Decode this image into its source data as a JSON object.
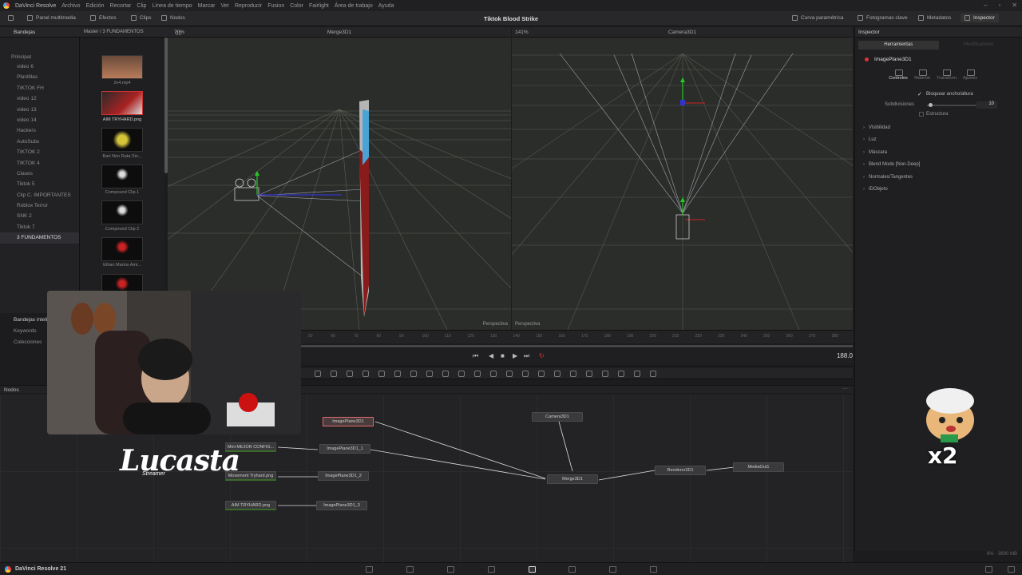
{
  "app": {
    "name": "DaVinci Resolve",
    "footer_name": "DaVinci Resolve 21"
  },
  "menu": [
    "Archivo",
    "Edición",
    "Recortar",
    "Clip",
    "Línea de tiempo",
    "Marcar",
    "Ver",
    "Reproducir",
    "Fusion",
    "Color",
    "Fairlight",
    "Área de trabajo",
    "Ayuda"
  ],
  "toolbar": {
    "media_pool": "Panel multimedia",
    "effects": "Efectos",
    "clips": "Clips",
    "nodes": "Nodos",
    "project_title": "Tiktok Blood Strike",
    "curves": "Curva paramétrica",
    "keyframes": "Fotogramas clave",
    "metadata": "Metadatos",
    "inspector": "Inspector"
  },
  "media_pool": {
    "bins_title": "Bandejas",
    "path": "Master / 3 FUNDAMENTOS",
    "root": "Principal",
    "bins": [
      "video 6",
      "Plantillas",
      "TIKTOK FH",
      "video 12",
      "video 13",
      "video 14",
      "Hackers",
      "AutoSubs",
      "TIKTOK 2",
      "TIKTOK 4",
      "Clases",
      "Tiktok 5",
      "Clip C. IMPORTANTES",
      "Roblox Terror",
      "SNK 2",
      "Tiktok 7",
      "3 FUNDAMENTOS"
    ],
    "selected_bin": "3 FUNDAMENTOS",
    "smart_bins_title": "Bandejas inteligentes",
    "smart_bins": [
      "Keywords",
      "Colecciones"
    ],
    "clips": [
      "2v4.mp4",
      "AIM TRYHARD.png",
      "Bart Nrio Rata Sin...",
      "Compound Clip 1",
      "Compound Clip 2",
      "Ethan Marios Ami..."
    ]
  },
  "viewer_left": {
    "title": "Merge3D1",
    "zoom": "70%",
    "label": "Perspectiva"
  },
  "viewer_right": {
    "title": "Camera3D1",
    "zoom": "141%",
    "label": "Perspectiva"
  },
  "timeline": {
    "ticks": [
      "50",
      "60",
      "70",
      "80",
      "90",
      "100",
      "110",
      "120",
      "130",
      "140",
      "150",
      "160",
      "170",
      "180",
      "190",
      "200",
      "210",
      "220",
      "230",
      "240",
      "250",
      "260",
      "270",
      "280",
      "290"
    ],
    "current_frame": "188.0"
  },
  "nodes_panel": {
    "title": "Nodos",
    "nodes": {
      "imageplane": "ImagePlane3D1",
      "imageplane1": "ImagePlane3D1_1",
      "imageplane2": "ImagePlane3D1_2",
      "imageplane3": "ImagePlane3D1_3",
      "loader1": "Mini MEJOR CONFIG...",
      "loader2": "Movement Tryhard.png",
      "loader3": "AIM TRYHARD.png",
      "camera": "Camera3D1",
      "merge": "Merge3D1",
      "renderer": "Renderer3D1",
      "mediaout": "MediaOut1"
    }
  },
  "inspector": {
    "title": "Inspector",
    "tabs": [
      "Herramientas",
      "Modificadores"
    ],
    "tool_name": "ImagePlane3D1",
    "subtabs": [
      "Controles",
      "Material",
      "Transform.",
      "Ajustes"
    ],
    "lock_label": "Bloquear ancho/altura",
    "subdivisions_label": "Subdivisiones",
    "subdivisions_value": "10",
    "wireframe_label": "Estructura",
    "sections": [
      "Visibilidad",
      "Luz",
      "Máscara",
      "Blend Mode [Non-Deep]",
      "Normales/Tangentes",
      "IDObjeto"
    ],
    "memory": "6% - 3890 MB"
  },
  "overlay": {
    "logo": "Lucasta",
    "logo_sub": "Streamer",
    "badge": "x2"
  }
}
